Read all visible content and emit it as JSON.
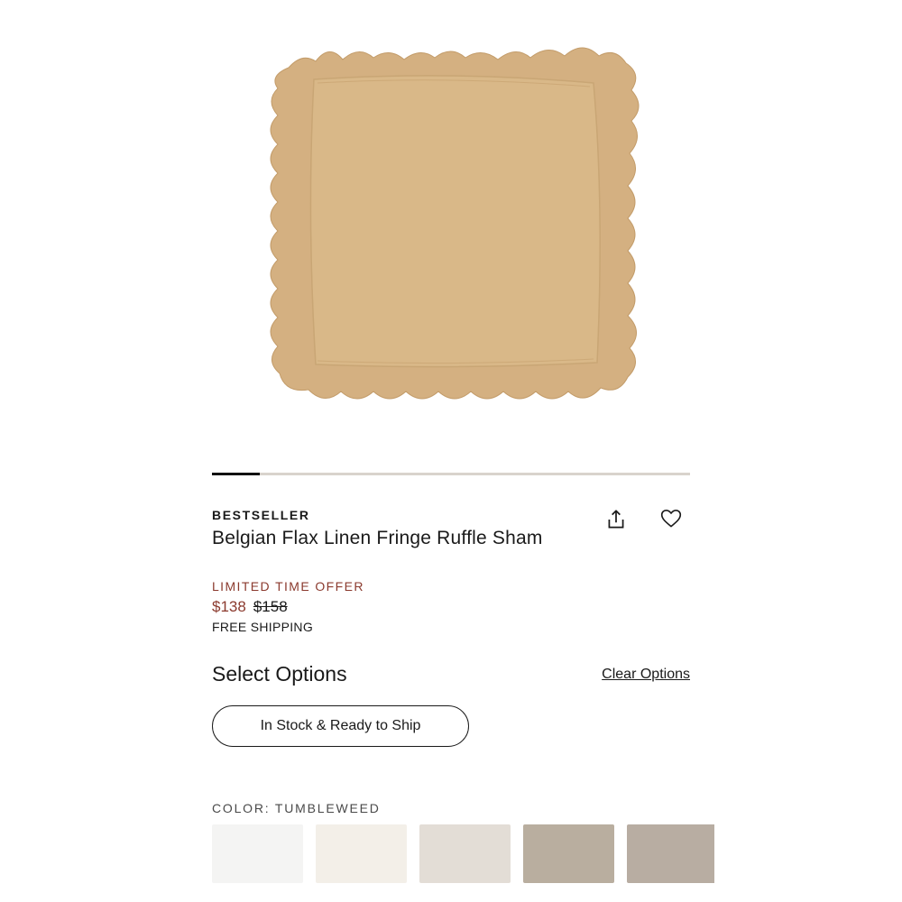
{
  "product": {
    "badge": "BESTSELLER",
    "title": "Belgian Flax Linen Fringe Ruffle Sham",
    "image_color": "#d9b888"
  },
  "carousel": {
    "current_position_fraction": 0.1
  },
  "pricing": {
    "offer_label": "LIMITED TIME OFFER",
    "sale_price": "$138",
    "original_price": "$158",
    "shipping": "FREE SHIPPING",
    "sale_color": "#8b3a2e"
  },
  "actions": {
    "share_icon": "share-icon",
    "favorite_icon": "heart-icon"
  },
  "options": {
    "heading": "Select Options",
    "clear_label": "Clear Options",
    "availability_filter": "In Stock & Ready to Ship"
  },
  "color": {
    "label": "COLOR: TUMBLEWEED",
    "swatches": [
      {
        "color": "#f4f4f3"
      },
      {
        "color": "#f3efe8"
      },
      {
        "color": "#e3ddd6"
      },
      {
        "color": "#b9ae9f"
      },
      {
        "color": "#b8ada2"
      }
    ]
  }
}
